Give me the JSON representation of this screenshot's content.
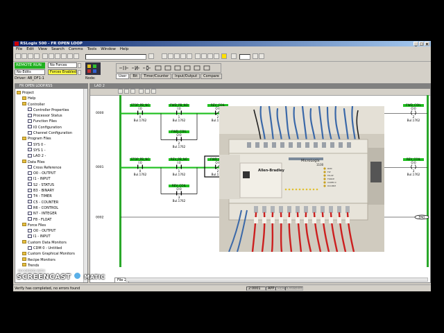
{
  "window": {
    "title": "RSLogix 500 - FR OPEN LOOP",
    "controls": [
      "_",
      "□",
      "x"
    ]
  },
  "menu": [
    "File",
    "Edit",
    "View",
    "Search",
    "Comms",
    "Tools",
    "Window",
    "Help"
  ],
  "status": {
    "mode": "REMOTE RUN",
    "no_edits": "No Edits",
    "no_forces": "No Forces",
    "forces_enabled": "Forces Enabled",
    "driver": "Driver:  AB_DF1-1",
    "node": "Node:"
  },
  "instruction_tabs": [
    "User",
    "Bit",
    "Timer/Counter",
    "Input/Output",
    "Compare"
  ],
  "project_panel": {
    "title": "FR OPEN LOOP.RSS",
    "tree": [
      {
        "label": "Project",
        "indent": 0,
        "icon": "folder"
      },
      {
        "label": "Help",
        "indent": 1,
        "icon": "folder"
      },
      {
        "label": "Controller",
        "indent": 1,
        "icon": "folder"
      },
      {
        "label": "Controller Properties",
        "indent": 2,
        "icon": "file"
      },
      {
        "label": "Processor Status",
        "indent": 2,
        "icon": "file"
      },
      {
        "label": "Function Files",
        "indent": 2,
        "icon": "file"
      },
      {
        "label": "IO Configuration",
        "indent": 2,
        "icon": "file"
      },
      {
        "label": "Channel Configuration",
        "indent": 2,
        "icon": "file"
      },
      {
        "label": "Program Files",
        "indent": 1,
        "icon": "folder"
      },
      {
        "label": "SYS 0 -",
        "indent": 2,
        "icon": "file"
      },
      {
        "label": "SYS 1 -",
        "indent": 2,
        "icon": "file"
      },
      {
        "label": "LAD 2 -",
        "indent": 2,
        "icon": "file"
      },
      {
        "label": "Data Files",
        "indent": 1,
        "icon": "folder"
      },
      {
        "label": "Cross Reference",
        "indent": 2,
        "icon": "file"
      },
      {
        "label": "O0 - OUTPUT",
        "indent": 2,
        "icon": "file"
      },
      {
        "label": "I1 - INPUT",
        "indent": 2,
        "icon": "file"
      },
      {
        "label": "S2 - STATUS",
        "indent": 2,
        "icon": "file"
      },
      {
        "label": "B3 - BINARY",
        "indent": 2,
        "icon": "file"
      },
      {
        "label": "T4 - TIMER",
        "indent": 2,
        "icon": "file"
      },
      {
        "label": "C5 - COUNTER",
        "indent": 2,
        "icon": "file"
      },
      {
        "label": "R6 - CONTROL",
        "indent": 2,
        "icon": "file"
      },
      {
        "label": "N7 - INTEGER",
        "indent": 2,
        "icon": "file"
      },
      {
        "label": "F8 - FLOAT",
        "indent": 2,
        "icon": "file"
      },
      {
        "label": "Force Files",
        "indent": 1,
        "icon": "folder"
      },
      {
        "label": "O0 - OUTPUT",
        "indent": 2,
        "icon": "file"
      },
      {
        "label": "I1 - INPUT",
        "indent": 2,
        "icon": "file"
      },
      {
        "label": "Custom Data Monitors",
        "indent": 1,
        "icon": "folder"
      },
      {
        "label": "CDM 0 - Untitled",
        "indent": 2,
        "icon": "file"
      },
      {
        "label": "Custom Graphical Monitors",
        "indent": 1,
        "icon": "folder"
      },
      {
        "label": "Recipe Monitors",
        "indent": 1,
        "icon": "folder"
      },
      {
        "label": "Trends",
        "indent": 1,
        "icon": "folder"
      }
    ]
  },
  "ladder_window": {
    "title": "LAD 2",
    "file_tab": "File 2",
    "rung_numbers": [
      "0000",
      "0001",
      "0002"
    ],
    "rungs": [
      {
        "contacts": [
          {
            "tag": "STOP_PB_NC",
            "addr": "I:0",
            "bit": "0",
            "mod": "Bul.1762"
          },
          {
            "tag": "FWD_PB_NO",
            "addr": "I:0",
            "bit": "1",
            "mod": "Bul.1762"
          }
        ],
        "branch": {
          "tag": "FWD_COIL",
          "addr": "O:0",
          "bit": "2",
          "mod": "Bul.1762"
        },
        "interlock": {
          "tag": "REV_COIL",
          "addr": "O:0",
          "bit": "2",
          "mod": "Bul.1762"
        },
        "coil": {
          "tag": "FWD_COIL",
          "addr": "O:0",
          "bit": "2",
          "mod": "Bul.1762"
        }
      },
      {
        "contacts": [
          {
            "tag": "STOP_PB_NC",
            "addr": "I:0",
            "bit": "0",
            "mod": "Bul.1762"
          },
          {
            "tag": "REV_PB_NO",
            "addr": "I:0",
            "bit": "1",
            "mod": "Bul.1762"
          }
        ],
        "branch": {
          "tag": "REV_COIL",
          "addr": "O:0",
          "bit": "3",
          "mod": "Bul.1762"
        },
        "interlock": {
          "tag": "FWD_COIL",
          "addr": "O:0",
          "bit": "2",
          "mod": "Bul.1762"
        },
        "coil": {
          "tag": "REV_COIL",
          "addr": "O:0",
          "bit": "3",
          "mod": "Bul.1762"
        }
      }
    ],
    "end_label": "END"
  },
  "photo": {
    "brand": "Allen-Bradley",
    "model": "MicroLogix",
    "model_num": "1100",
    "leds": [
      "RUN",
      "FLT",
      "FAULT",
      "FORCE",
      "COMM 0",
      "DCOMM"
    ]
  },
  "statusbar": {
    "message": "Verify has completed, no errors found",
    "addr": "2:0001",
    "app": "APP",
    "read": "READ",
    "disabled": "Disabled"
  },
  "watermark": {
    "recorded": "RECORDED WITH",
    "brand": "SCREENCAST",
    "suffix": "MATIC"
  },
  "colors": {
    "energized": "#22c022",
    "rail": "#2aa82a",
    "mode_green": "#20b020",
    "forces_yellow": "#ffff40"
  }
}
